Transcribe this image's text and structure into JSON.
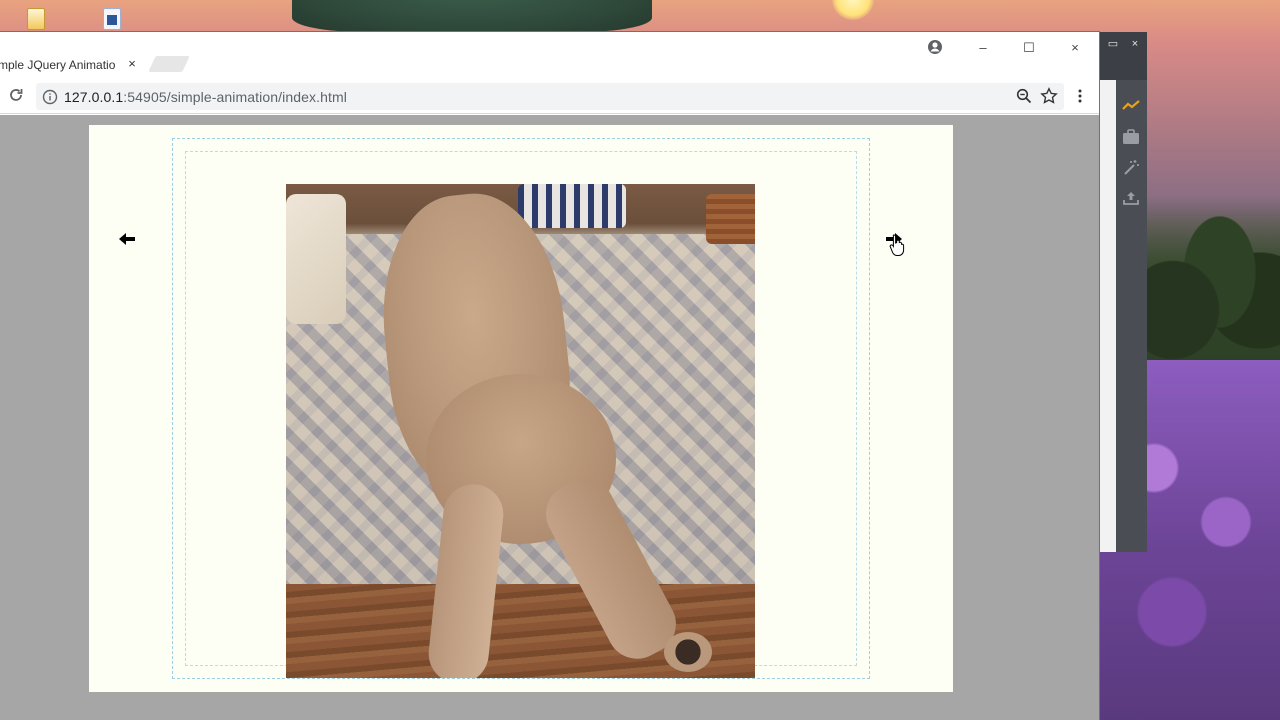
{
  "browser": {
    "tab": {
      "title": "mple JQuery Animation",
      "close_glyph": "×"
    },
    "window_controls": {
      "minimize": "–",
      "maximize": "☐",
      "close": "×"
    },
    "address": {
      "host": "127.0.0.1",
      "rest": ":54905/simple-animation/index.html"
    }
  },
  "page": {
    "prev_arrow": "prev",
    "next_arrow": "next",
    "photo_alt": "cat on bed"
  },
  "side_panel": {
    "controls": {
      "restore": "▭",
      "close": "×"
    },
    "tools": [
      "chart-icon",
      "briefcase-icon",
      "magic-wand-icon",
      "upload-icon"
    ],
    "accent_color": "#e8a21a"
  },
  "desktop": {
    "icons": [
      "folder-icon",
      "word-document-icon"
    ]
  },
  "colors": {
    "window_border": "#e0453a",
    "page_background": "#fdfef4",
    "viewport_gray": "#a6a6a6"
  }
}
